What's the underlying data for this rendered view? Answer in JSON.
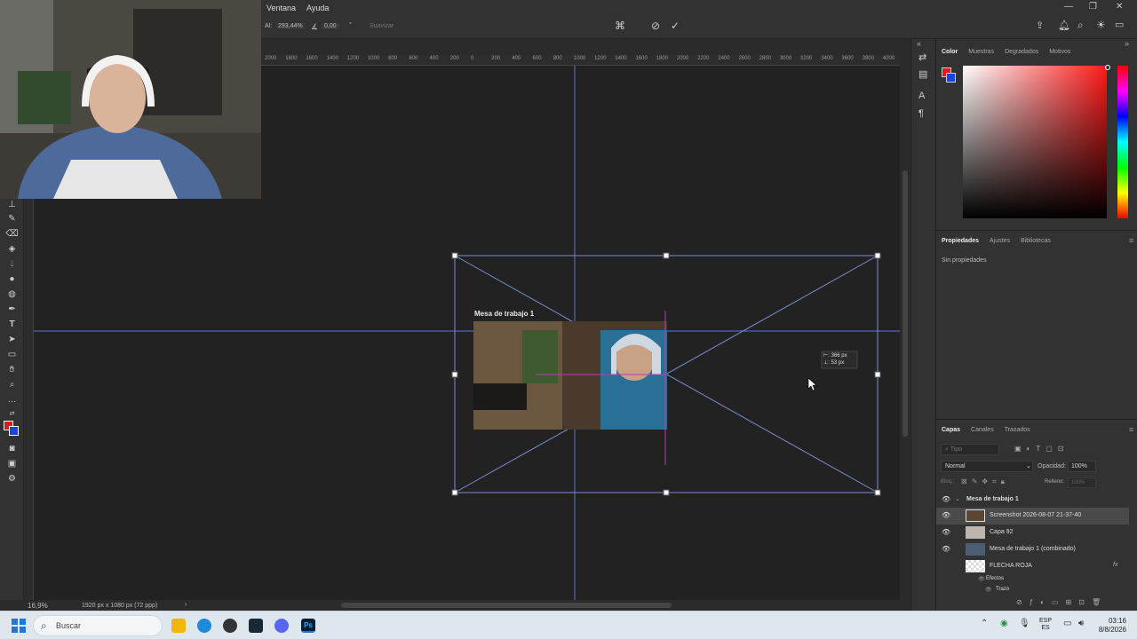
{
  "menu": {
    "items": [
      "Ventana",
      "Ayuda"
    ]
  },
  "options_bar": {
    "angle_prefix": "Al:",
    "angle_value": "293,44%",
    "rotate_value": "0,00",
    "interpolation": "Suavizar",
    "cancel_icon": "cancel-icon",
    "commit_icon": "check-icon"
  },
  "rulers": {
    "top_labels": [
      "2000",
      "1800",
      "1600",
      "1400",
      "1200",
      "1000",
      "800",
      "600",
      "400",
      "200",
      "0",
      "200",
      "400",
      "600",
      "800",
      "1000",
      "1200",
      "1400",
      "1600",
      "1800",
      "2000",
      "2200",
      "2400",
      "2600",
      "2800",
      "3000",
      "3200",
      "3400",
      "3600",
      "3800",
      "4000"
    ]
  },
  "canvas": {
    "artboard_label": "Mesa de trabajo 1",
    "transform_tooltip_w": "366 px",
    "transform_tooltip_h": "53 px",
    "tooltip_w_prefix": "⊢:",
    "tooltip_h_prefix": "⊥:"
  },
  "status": {
    "zoom": "16,9%",
    "doc_size": "1920 px x 1080 px (72 ppp)"
  },
  "color_panel": {
    "tabs": [
      "Color",
      "Muestras",
      "Degradados",
      "Motivos"
    ],
    "foreground": "#e8161b",
    "background": "#1747d8"
  },
  "properties_panel": {
    "tabs": [
      "Propiedades",
      "Ajustes",
      "Bibliotecas"
    ],
    "empty_text": "Sin propiedades"
  },
  "layers_panel": {
    "tabs": [
      "Capas",
      "Canales",
      "Trazados"
    ],
    "search_placeholder": "Tipo",
    "blend_mode": "Normal",
    "opacity_label": "Opacidad:",
    "opacity_value": "100%",
    "lock_label": "Bloq.:",
    "fill_label": "Relleno:",
    "fill_value": "100%",
    "group_name": "Mesa de trabajo 1",
    "layers": [
      {
        "name": "Screenshot 2026-08-07 21-37-40",
        "selected": true
      },
      {
        "name": "Capa 92",
        "selected": false
      },
      {
        "name": "Mesa de trabajo 1 (combinado)",
        "selected": false
      },
      {
        "name": "FLECHA ROJA",
        "selected": false,
        "fx": "fx"
      }
    ],
    "effects_label": "Efectos",
    "stroke_label": "Trazo"
  },
  "taskbar": {
    "search_placeholder": "Buscar",
    "lang_top": "ESP",
    "lang_bottom": "ES",
    "time": "03:16",
    "date": "8/8/2026"
  }
}
